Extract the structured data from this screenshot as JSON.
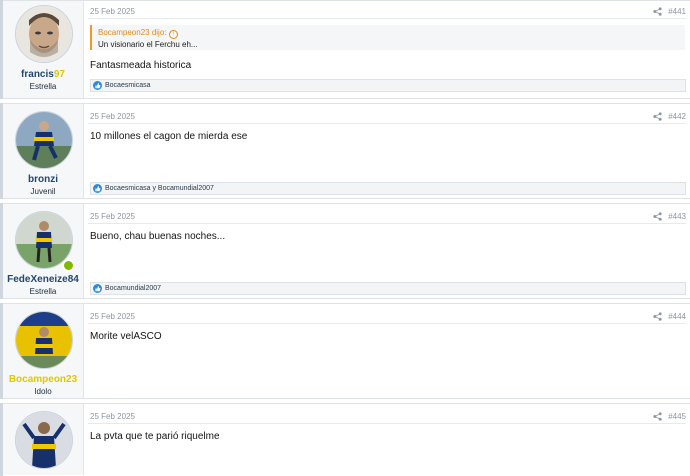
{
  "colors": {
    "username_blue": "#23476f",
    "username_gold": "#e0c800",
    "quote_accent": "#f19a22",
    "like_blue": "#2f8ade"
  },
  "posts": [
    {
      "date": "25 Feb 2025",
      "number": "#441",
      "user": {
        "name_part1": "francis",
        "name_part2": "97",
        "title": "Estrella"
      },
      "quote": {
        "author": "Bocampeon23 dijo:",
        "text": "Un visionario el Ferchu eh..."
      },
      "message": "Fantasmeada historica",
      "reactions": "Bocaesmicasa"
    },
    {
      "date": "25 Feb 2025",
      "number": "#442",
      "user": {
        "name": "bronzi",
        "title": "Juvenil"
      },
      "message": "10 millones el cagon de mierda ese",
      "reactions": "Bocaesmicasa y Bocamundial2007"
    },
    {
      "date": "25 Feb 2025",
      "number": "#443",
      "user": {
        "name": "FedeXeneize84",
        "title": "Estrella"
      },
      "message": "Bueno, chau buenas noches...",
      "reactions": "Bocamundial2007"
    },
    {
      "date": "25 Feb 2025",
      "number": "#444",
      "user": {
        "name": "Bocampeon23",
        "title": "Idolo"
      },
      "message": "Morite velASCO"
    },
    {
      "date": "25 Feb 2025",
      "number": "#445",
      "user": {
        "name": "",
        "title": ""
      },
      "message": "La pvta que te parió riquelme"
    }
  ]
}
